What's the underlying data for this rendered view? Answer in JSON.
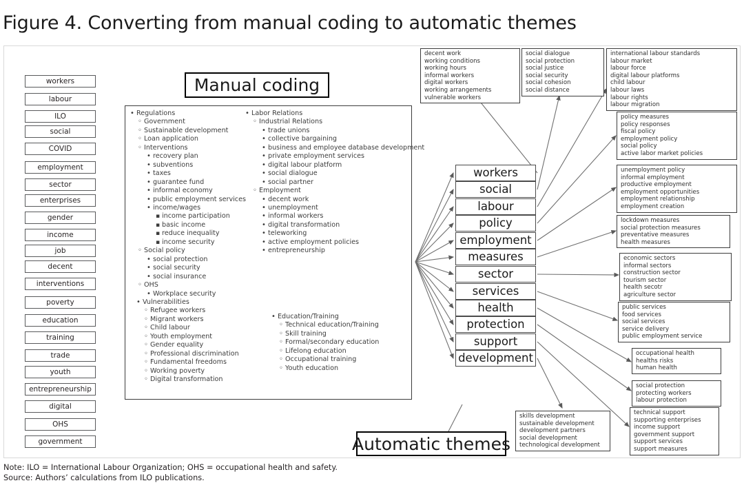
{
  "figure": {
    "title": "Figure 4. Converting from manual coding to automatic themes",
    "note": "Note: ILO = International Labour Organization; OHS = occupational health and safety.",
    "source": "Source: Authors’ calculations from ILO publications."
  },
  "labels": {
    "manual_coding": "Manual coding",
    "automatic_themes": "Automatic themes"
  },
  "keywords": [
    "workers",
    "labour",
    "ILO",
    "social",
    "COVID",
    "employment",
    "sector",
    "enterprises",
    "gender",
    "income",
    "job",
    "decent",
    "interventions",
    "poverty",
    "education",
    "training",
    "trade",
    "youth",
    "entrepreneurship",
    "digital",
    "OHS",
    "government"
  ],
  "outline": {
    "column_left": [
      {
        "level": 1,
        "text": "Regulations"
      },
      {
        "level": 2,
        "text": "Government"
      },
      {
        "level": 2,
        "text": "Sustainable development"
      },
      {
        "level": 2,
        "text": "Loan application"
      },
      {
        "level": 2,
        "text": "Interventions"
      },
      {
        "level": 3,
        "text": "recovery plan"
      },
      {
        "level": 3,
        "text": "subventions"
      },
      {
        "level": 3,
        "text": "taxes"
      },
      {
        "level": 3,
        "text": "guarantee fund"
      },
      {
        "level": 3,
        "text": "informal economy"
      },
      {
        "level": 3,
        "text": "public employment services"
      },
      {
        "level": 3,
        "text": "income/wages"
      },
      {
        "level": 4,
        "text": "income participation"
      },
      {
        "level": 4,
        "text": "basic income"
      },
      {
        "level": 4,
        "text": "reduce inequality"
      },
      {
        "level": 4,
        "text": "income security"
      },
      {
        "level": 2,
        "text": "Social policy"
      },
      {
        "level": 3,
        "text": "social protection"
      },
      {
        "level": 3,
        "text": "social security"
      },
      {
        "level": 3,
        "text": "social insurance"
      },
      {
        "level": 2,
        "text": "OHS"
      },
      {
        "level": 3,
        "text": "Workplace security"
      }
    ],
    "column_left_lower": [
      {
        "level": 1,
        "text": "Vulnerabilities"
      },
      {
        "level": 2,
        "text": "Refugee workers"
      },
      {
        "level": 2,
        "text": "Migrant workers"
      },
      {
        "level": 2,
        "text": "Child labour"
      },
      {
        "level": 2,
        "text": "Youth employment"
      },
      {
        "level": 2,
        "text": "Gender equality"
      },
      {
        "level": 2,
        "text": "Professional discrimination"
      },
      {
        "level": 2,
        "text": "Fundamental freedoms"
      },
      {
        "level": 2,
        "text": "Working poverty"
      },
      {
        "level": 2,
        "text": "Digital transformation"
      }
    ],
    "column_right": [
      {
        "level": 1,
        "text": "Labor Relations"
      },
      {
        "level": 2,
        "text": "Industrial Relations"
      },
      {
        "level": 3,
        "text": "trade unions"
      },
      {
        "level": 3,
        "text": "collective bargaining"
      },
      {
        "level": 3,
        "text": "business and employee database development"
      },
      {
        "level": 3,
        "text": "private employment services"
      },
      {
        "level": 3,
        "text": "digital labour platform"
      },
      {
        "level": 3,
        "text": "social dialogue"
      },
      {
        "level": 3,
        "text": "social partner"
      },
      {
        "level": 2,
        "text": "Employment"
      },
      {
        "level": 3,
        "text": "decent work"
      },
      {
        "level": 3,
        "text": "unemployment"
      },
      {
        "level": 3,
        "text": "informal workers"
      },
      {
        "level": 3,
        "text": "digital transformation"
      },
      {
        "level": 3,
        "text": "teleworking"
      },
      {
        "level": 3,
        "text": "active employment policies"
      },
      {
        "level": 3,
        "text": "entrepreneurship"
      }
    ],
    "column_right_lower": [
      {
        "level": 1,
        "text": "Education/Training"
      },
      {
        "level": 2,
        "text": "Technical education/Training"
      },
      {
        "level": 2,
        "text": "Skill training"
      },
      {
        "level": 2,
        "text": "Formal/secondary education"
      },
      {
        "level": 2,
        "text": "Lifelong education"
      },
      {
        "level": 2,
        "text": "Occupational training"
      },
      {
        "level": 2,
        "text": "Youth education"
      }
    ]
  },
  "themes": [
    "workers",
    "social",
    "labour",
    "policy",
    "employment",
    "measures",
    "sector",
    "services",
    "health",
    "protection",
    "support",
    "development"
  ],
  "termboxes": [
    {
      "id": "workers-terms",
      "terms": [
        "decent work",
        "working conditions",
        "working hours",
        "informal workers",
        "digital workers",
        "working arrangements",
        "vulnerable workers"
      ]
    },
    {
      "id": "social-terms",
      "terms": [
        "social dialogue",
        "social protection",
        "social justice",
        "social security",
        "social cohesion",
        "social distance"
      ]
    },
    {
      "id": "labour-terms",
      "terms": [
        "international labour standards",
        "labour market",
        "labour force",
        "digital labour platforms",
        "child labour",
        "labour laws",
        "labour rights",
        "labour migration"
      ]
    },
    {
      "id": "policy-terms",
      "terms": [
        "policy measures",
        "policy responses",
        "fiscal policy",
        "employment policy",
        "social policy",
        "active labor market policies"
      ]
    },
    {
      "id": "employment-terms",
      "terms": [
        "unemployment policy",
        "informal employment",
        "productive employment",
        "employment opportunities",
        "employment relationship",
        "employment creation"
      ]
    },
    {
      "id": "measures-terms",
      "terms": [
        "lockdown measures",
        "social protection measures",
        "preventative measures",
        "health measures"
      ]
    },
    {
      "id": "sector-terms",
      "terms": [
        "economic sectors",
        "informal sectors",
        "construction sector",
        "tourism sector",
        "health secotr",
        "agriculture sector"
      ]
    },
    {
      "id": "services-terms",
      "terms": [
        "public services",
        "food services",
        "social services",
        "service delivery",
        "public employment service"
      ]
    },
    {
      "id": "health-terms",
      "terms": [
        "occupational health",
        "healths risks",
        "human health"
      ]
    },
    {
      "id": "protection-terms",
      "terms": [
        "social protection",
        "protecting workers",
        "labour protection"
      ]
    },
    {
      "id": "support-terms",
      "terms": [
        "technical support",
        "supporting enterprises",
        "income support",
        "government support",
        "support services",
        "support measures"
      ]
    },
    {
      "id": "development-terms",
      "terms": [
        "skills development",
        "sustainable development",
        "development partners",
        "social development",
        "technological development"
      ]
    }
  ],
  "colors": {
    "text": "#231f20",
    "box_border": "#3b3b3b",
    "chip_border": "#58595b",
    "canvas_border": "#d8d8d8",
    "arrow": "#6f6f6f"
  }
}
